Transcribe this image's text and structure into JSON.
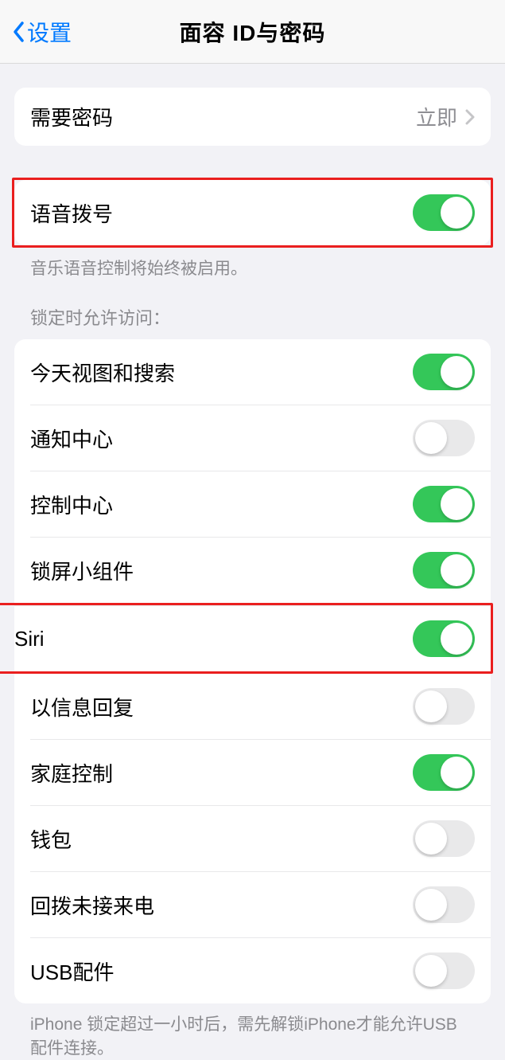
{
  "nav": {
    "back": "设置",
    "title": "面容 ID与密码"
  },
  "passcode": {
    "label": "需要密码",
    "value": "立即"
  },
  "voiceDial": {
    "label": "语音拨号",
    "on": true,
    "footer": "音乐语音控制将始终被启用。"
  },
  "lockedAccess": {
    "header": "锁定时允许访问：",
    "items": [
      {
        "label": "今天视图和搜索",
        "on": true
      },
      {
        "label": "通知中心",
        "on": false
      },
      {
        "label": "控制中心",
        "on": true
      },
      {
        "label": "锁屏小组件",
        "on": true
      },
      {
        "label": "Siri",
        "on": true
      },
      {
        "label": "以信息回复",
        "on": false
      },
      {
        "label": "家庭控制",
        "on": true
      },
      {
        "label": "钱包",
        "on": false
      },
      {
        "label": "回拨未接来电",
        "on": false
      },
      {
        "label": "USB配件",
        "on": false
      }
    ],
    "footer": "iPhone 锁定超过一小时后，需先解锁iPhone才能允许USB 配件连接。"
  }
}
